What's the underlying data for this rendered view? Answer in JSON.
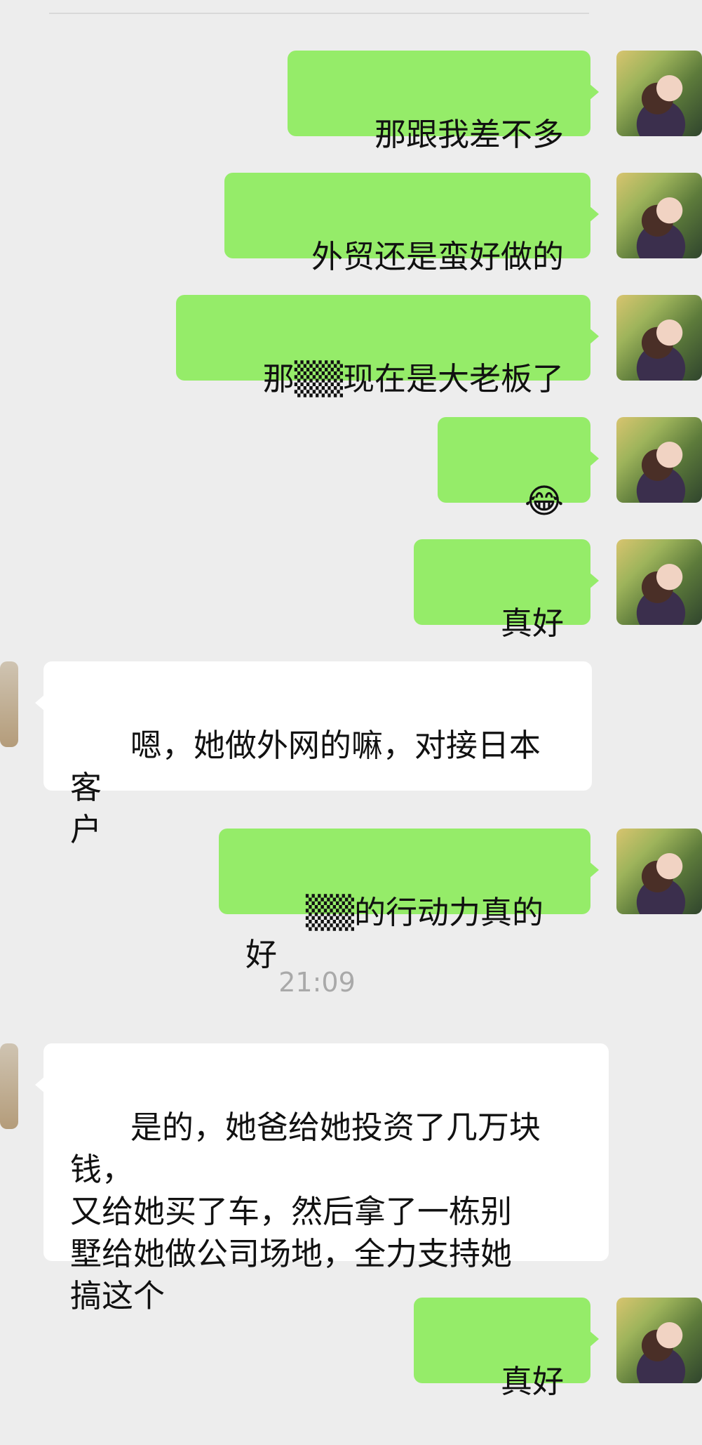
{
  "messages": [
    {
      "from": "me",
      "text": "那跟我差不多"
    },
    {
      "from": "me",
      "text": "外贸还是蛮好做的"
    },
    {
      "from": "me",
      "text": "那▒▒现在是大老板了"
    },
    {
      "from": "me",
      "text": "😂"
    },
    {
      "from": "me",
      "text": "真好"
    },
    {
      "from": "other",
      "text": "嗯，她做外网的嘛，对接日本客\n户"
    },
    {
      "from": "me",
      "text": "▒▒的行动力真的好"
    },
    {
      "from": "other",
      "text": "是的，她爸给她投资了几万块钱，\n又给她买了车，然后拿了一栋别\n墅给她做公司场地，全力支持她\n搞这个"
    },
    {
      "from": "me",
      "text": "真好"
    }
  ],
  "timestamp": "21:09",
  "icons": {
    "my_avatar": "user-photo-avatar",
    "other_avatar": "contact-avatar",
    "emoji": "laughing-tears-emoji"
  }
}
